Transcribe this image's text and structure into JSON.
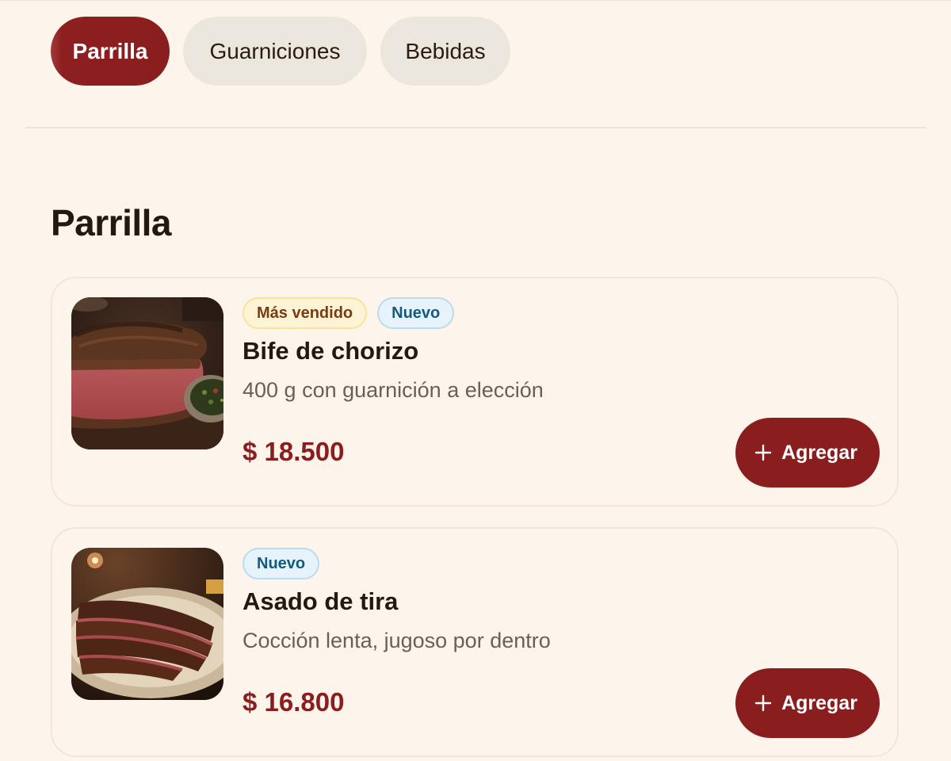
{
  "tabs": [
    {
      "label": "Parrilla",
      "active": true
    },
    {
      "label": "Guarniciones",
      "active": false
    },
    {
      "label": "Bebidas",
      "active": false
    }
  ],
  "section": {
    "title": "Parrilla"
  },
  "items": [
    {
      "badges": [
        "Más vendido",
        "Nuevo"
      ],
      "name": "Bife de chorizo",
      "description": "400 g con guarnición a elección",
      "price": "$ 18.500",
      "add_label": "Agregar",
      "image_icon": "steak-photo"
    },
    {
      "badges": [
        "Nuevo"
      ],
      "name": "Asado de tira",
      "description": "Cocción lenta, jugoso por dentro",
      "price": "$ 16.800",
      "add_label": "Agregar",
      "image_icon": "sliced-asado-photo"
    }
  ],
  "colors": {
    "background": "#fdf5ec",
    "accent": "#8a1d1e",
    "tab_inactive": "#ebe7df",
    "badge_best_bg": "#fdf4d6",
    "badge_new_bg": "#e7f3fb",
    "text_muted": "#6b5e57"
  }
}
